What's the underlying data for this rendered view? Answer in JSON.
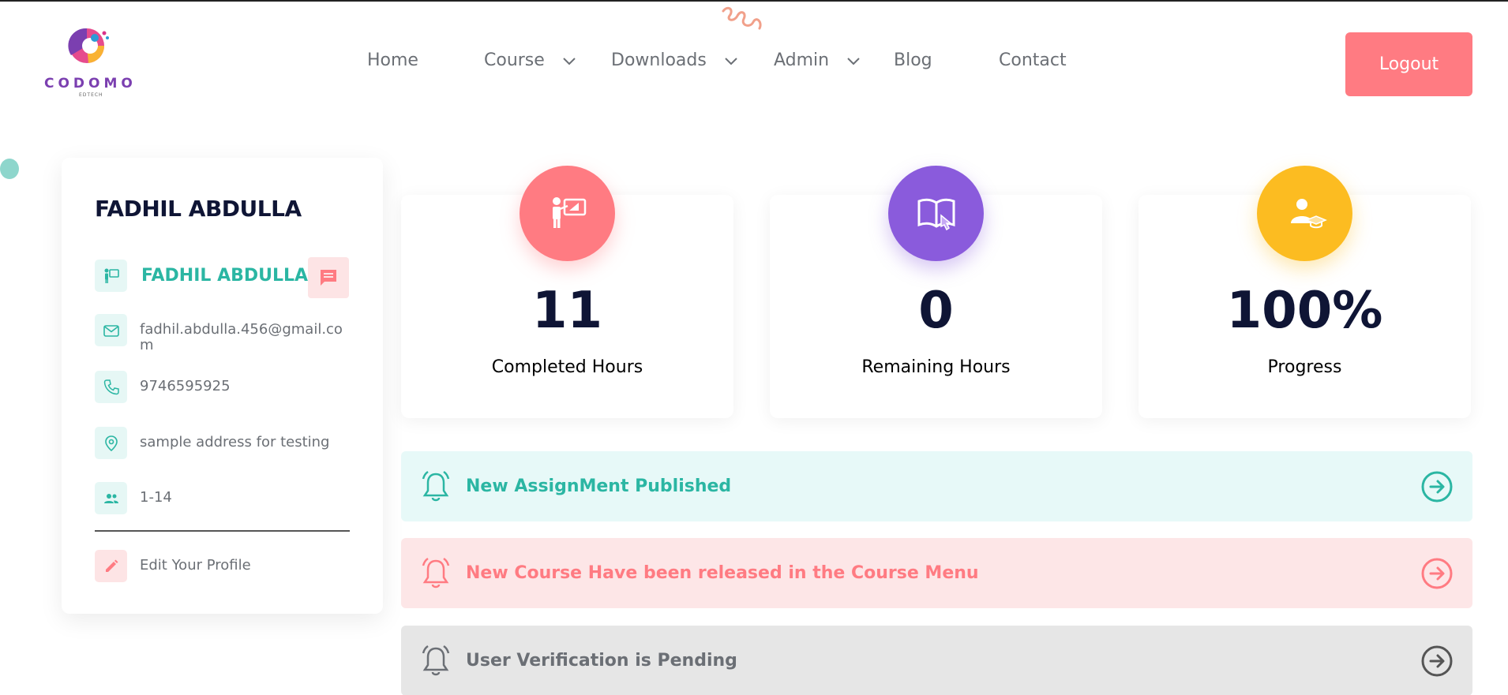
{
  "brand": {
    "name": "CODOMO",
    "tagline": "EDTECH"
  },
  "nav": {
    "home": "Home",
    "course": "Course",
    "downloads": "Downloads",
    "admin": "Admin",
    "blog": "Blog",
    "contact": "Contact"
  },
  "header": {
    "logout_label": "Logout"
  },
  "profile": {
    "title": "FADHIL ABDULLA",
    "name": "FADHIL ABDULLA",
    "email": "fadhil.abdulla.456@gmail.com",
    "phone": "9746595925",
    "address": "sample address for testing",
    "group": "1-14",
    "edit_label": "Edit Your Profile"
  },
  "stats": [
    {
      "value": "11",
      "label": "Completed Hours",
      "color": "#ff7b82",
      "icon": "teacher-board-icon"
    },
    {
      "value": "0",
      "label": "Remaining Hours",
      "color": "#8a5bdc",
      "icon": "book-touch-icon"
    },
    {
      "value": "100%",
      "label": "Progress",
      "color": "#fcbc21",
      "icon": "graduate-user-icon"
    }
  ],
  "alerts": [
    {
      "text": "New AssignMent Published",
      "bg": "#e7f9f8",
      "color": "#2bb6a3"
    },
    {
      "text": "New Course Have been released in the Course Menu",
      "bg": "#fde6e7",
      "color": "#ff7b82"
    },
    {
      "text": "User Verification is Pending",
      "bg": "#e6e6e6",
      "color": "#6b6f75"
    }
  ],
  "colors": {
    "accent": "#ff7b82",
    "teal": "#2bb6a3",
    "dark": "#0f1535"
  }
}
